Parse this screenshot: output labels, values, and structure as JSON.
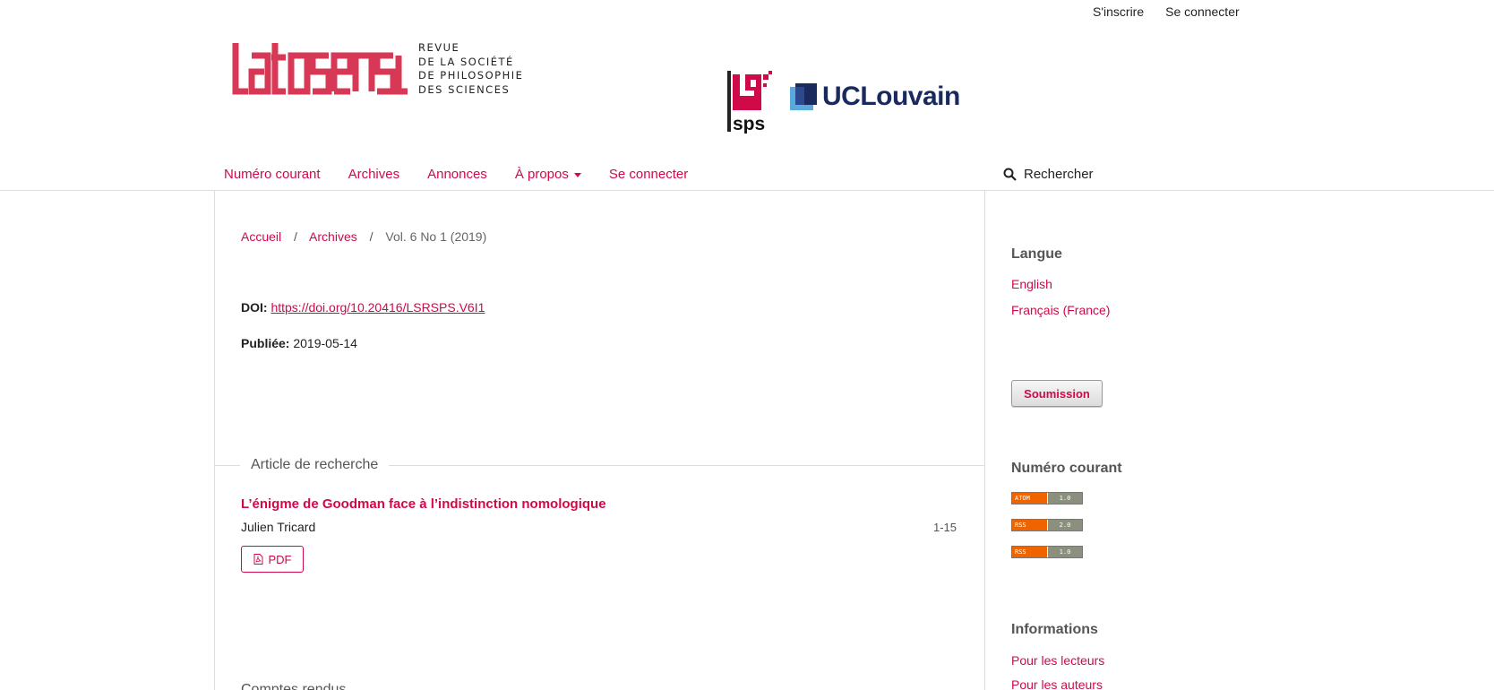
{
  "user_nav": {
    "register": "S'inscrire",
    "login": "Se connecter"
  },
  "header": {
    "logo_tagline": [
      "REVUE",
      "DE LA SOCIÉTÉ",
      "DE PHILOSOPHIE",
      "DES SCIENCES"
    ],
    "sps_text": "sps",
    "uclouvain_text": "UCLouvain"
  },
  "nav": {
    "items": [
      "Numéro courant",
      "Archives",
      "Annonces",
      "À propos",
      "Se connecter"
    ],
    "search": "Rechercher"
  },
  "breadcrumb": {
    "home": "Accueil",
    "archives": "Archives",
    "current": "Vol. 6 No 1 (2019)",
    "separator": "/"
  },
  "issue": {
    "doi_label": "DOI:",
    "doi_url": "https://doi.org/10.20416/LSRSPS.V6I1",
    "published_label": "Publiée:",
    "published_date": "2019-05-14"
  },
  "section": {
    "title": "Article de recherche",
    "next_heading_partial": "Comptes rendus"
  },
  "article": {
    "title": "L’énigme de Goodman face à l’indistinction nomologique",
    "author": "Julien Tricard",
    "pages": "1-15",
    "pdf_label": "PDF"
  },
  "sidebar": {
    "language_heading": "Langue",
    "languages": [
      "English",
      "Français (France)"
    ],
    "submit_label": "Soumission",
    "current_heading": "Numéro courant",
    "feeds": [
      {
        "left": "ATOM",
        "right": "1.0"
      },
      {
        "left": "RSS",
        "right": "2.0"
      },
      {
        "left": "RSS",
        "right": "1.0"
      }
    ],
    "info_heading": "Informations",
    "info_links": [
      "Pour les lecteurs",
      "Pour les auteurs"
    ]
  },
  "colors": {
    "accent": "#d00a48",
    "text": "#222222",
    "rule": "#dddddd",
    "ucl_blue": "#1a2a5e"
  }
}
